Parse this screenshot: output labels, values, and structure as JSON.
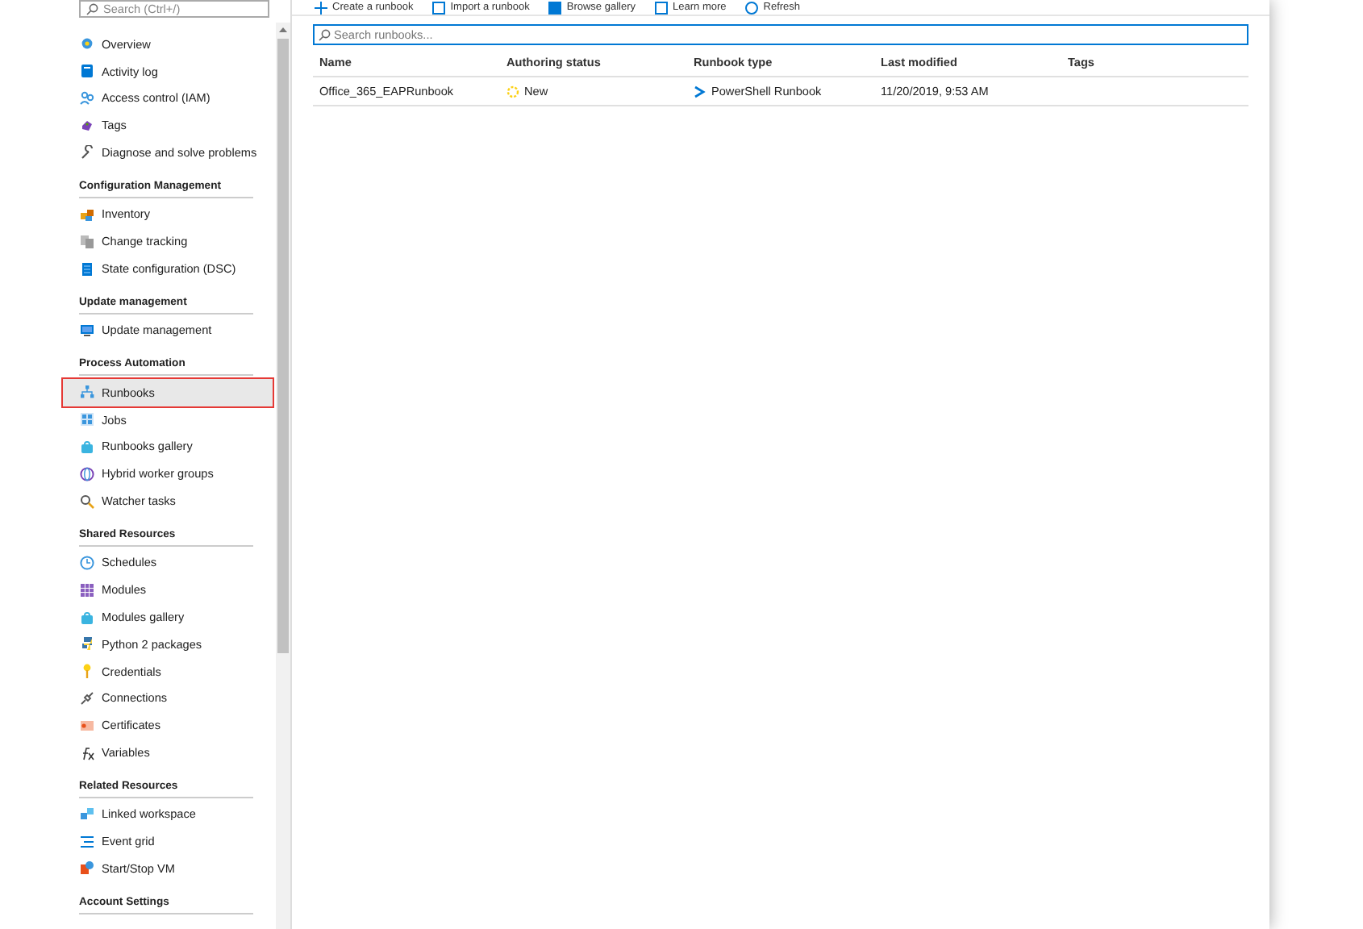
{
  "toolbar": [
    {
      "label": "Create a runbook"
    },
    {
      "label": "Import a runbook"
    },
    {
      "label": "Browse gallery"
    },
    {
      "label": "Learn more"
    },
    {
      "label": "Refresh"
    }
  ],
  "sidebar": {
    "search": {
      "placeholder": "Search (Ctrl+/)"
    },
    "groups": [
      {
        "items": [
          {
            "label": "Overview",
            "selected": false
          },
          {
            "label": "Activity log",
            "selected": false
          },
          {
            "label": "Access control (IAM)",
            "selected": false
          },
          {
            "label": "Tags",
            "selected": false
          },
          {
            "label": "Diagnose and solve problems",
            "selected": false
          }
        ]
      },
      {
        "heading": "Configuration Management",
        "items": [
          {
            "label": "Inventory",
            "selected": false
          },
          {
            "label": "Change tracking",
            "selected": false
          },
          {
            "label": "State configuration (DSC)",
            "selected": false
          }
        ]
      },
      {
        "heading": "Update management",
        "items": [
          {
            "label": "Update management",
            "selected": false
          }
        ]
      },
      {
        "heading": "Process Automation",
        "items": [
          {
            "label": "Runbooks",
            "selected": true,
            "annotated": true
          },
          {
            "label": "Jobs",
            "selected": false
          },
          {
            "label": "Runbooks gallery",
            "selected": false
          },
          {
            "label": "Hybrid worker groups",
            "selected": false
          },
          {
            "label": "Watcher tasks",
            "selected": false
          }
        ]
      },
      {
        "heading": "Shared Resources",
        "items": [
          {
            "label": "Schedules",
            "selected": false
          },
          {
            "label": "Modules",
            "selected": false
          },
          {
            "label": "Modules gallery",
            "selected": false
          },
          {
            "label": "Python 2 packages",
            "selected": false
          },
          {
            "label": "Credentials",
            "selected": false
          },
          {
            "label": "Connections",
            "selected": false
          },
          {
            "label": "Certificates",
            "selected": false
          },
          {
            "label": "Variables",
            "selected": false
          }
        ]
      },
      {
        "heading": "Related Resources",
        "items": [
          {
            "label": "Linked workspace",
            "selected": false
          },
          {
            "label": "Event grid",
            "selected": false
          },
          {
            "label": "Start/Stop VM",
            "selected": false
          }
        ]
      },
      {
        "heading": "Account Settings"
      }
    ]
  },
  "search": {
    "placeholder": "Search runbooks..."
  },
  "table": {
    "columns": [
      "Name",
      "Authoring status",
      "Runbook type",
      "Last modified",
      "Tags"
    ],
    "rows": [
      {
        "name": "Office_365_EAPRunbook",
        "status": "New",
        "type": "PowerShell Runbook",
        "modified": "11/20/2019, 9:53 AM"
      }
    ]
  }
}
